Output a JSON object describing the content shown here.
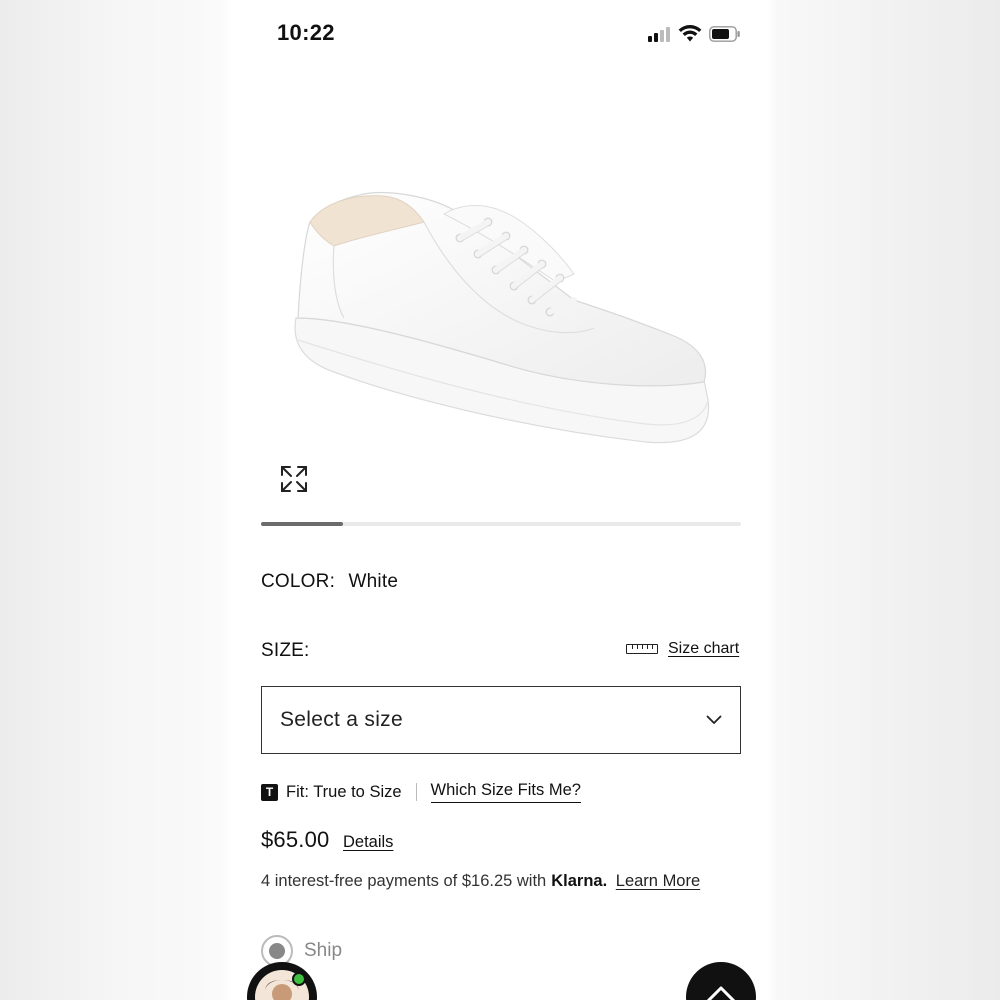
{
  "status_bar": {
    "time": "10:22"
  },
  "product": {
    "image_icon": "white-sneaker",
    "color_label": "COLOR:",
    "color_value": "White",
    "carousel_progress": 0.17
  },
  "size": {
    "label": "SIZE:",
    "size_chart_label": "Size chart",
    "select_placeholder": "Select a size"
  },
  "fit": {
    "badge": "T",
    "fit_text": "Fit: True to Size",
    "which_size_link": "Which Size Fits Me?"
  },
  "pricing": {
    "price": "$65.00",
    "details_link": "Details",
    "klarna_text": "4 interest-free payments of $16.25 with",
    "klarna_brand": "Klarna.",
    "learn_more_link": "Learn More"
  },
  "shipping": {
    "ship_label": "Ship"
  },
  "colors": {
    "text": "#111111",
    "muted": "#888888",
    "online_indicator": "#3fbf3f"
  }
}
